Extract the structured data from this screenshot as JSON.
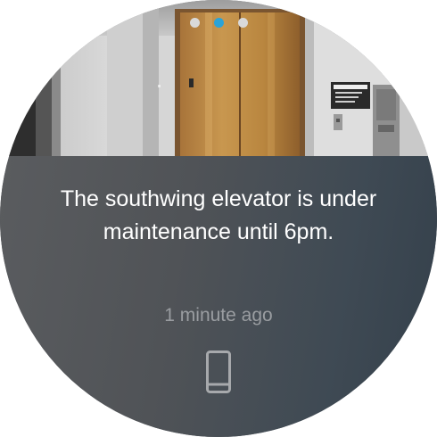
{
  "pager": {
    "pages": 3,
    "active_index": 1,
    "active_color": "#2aa3d8",
    "inactive_color": "#d9d9d9"
  },
  "hero": {
    "sign_title": "ACADEMIC ELEVATORS",
    "sign_number": "1070"
  },
  "notification": {
    "message": "The southwing elevator is under maintenance until 6pm.",
    "timestamp": "1 minute ago",
    "source_icon": "phone-icon"
  }
}
